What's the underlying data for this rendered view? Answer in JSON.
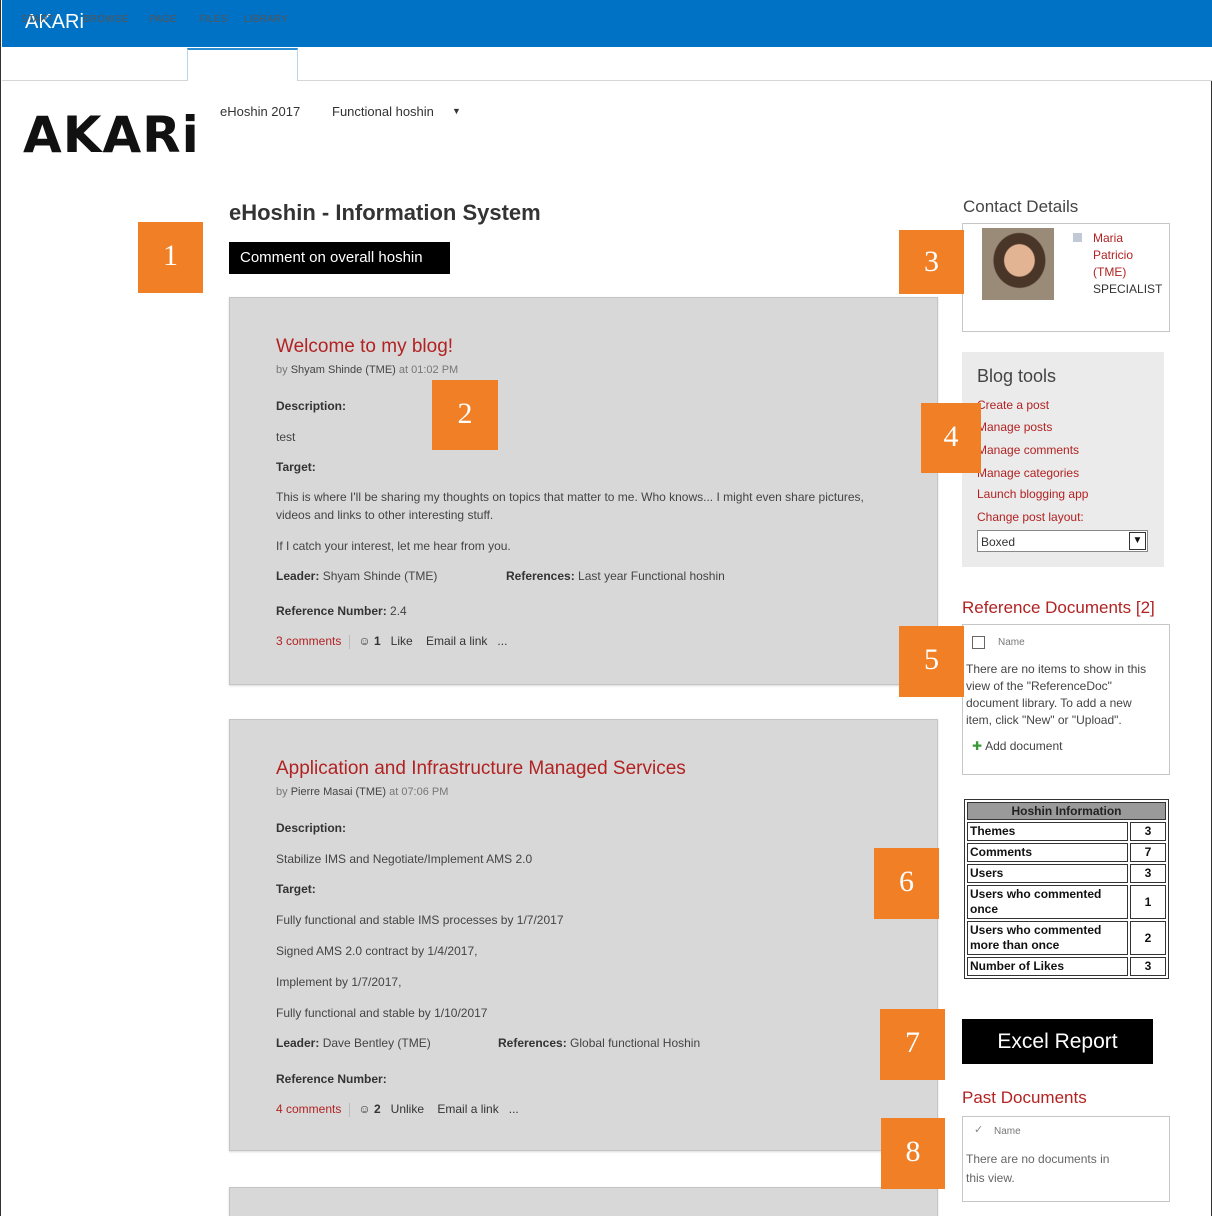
{
  "app": {
    "title": "AKARi",
    "logo_text": "AKARi"
  },
  "ribbon": {
    "tabs": [
      "START",
      "BROWSE",
      "PAGE",
      "FILES",
      "LIBRARY"
    ],
    "active_tabs": [
      "FILES",
      "LIBRARY"
    ]
  },
  "topnav": {
    "items": [
      "eHoshin 2017",
      "Functional hoshin"
    ],
    "dropdown_icon": "caret-down-icon"
  },
  "main": {
    "title": "eHoshin - Information System",
    "comment_button": "Comment on overall hoshin",
    "labels": {
      "description": "Description:",
      "target": "Target:",
      "leader": "Leader:",
      "references": "References:",
      "reference_number": "Reference Number:"
    },
    "posts": [
      {
        "title": "Welcome to my blog!",
        "by_prefix": "by",
        "author": "Shyam Shinde (TME)",
        "at": "at 01:02 PM",
        "description": "test",
        "target_lines": [
          "This is where I'll be sharing my thoughts on topics that matter to me. Who knows... I might even share pictures, videos and links to other interesting stuff.",
          "If I catch your interest, let me hear from you."
        ],
        "leader": "Shyam Shinde (TME)",
        "references": "Last year Functional hoshin",
        "reference_number": "2.4",
        "comments": "3 comments",
        "likes": "1",
        "like_action": "Like",
        "email_link": "Email a link",
        "more": "..."
      },
      {
        "title": "Application and Infrastructure Managed Services",
        "by_prefix": "by",
        "author": "Pierre Masai (TME)",
        "at": "at 07:06 PM",
        "description": "Stabilize IMS and Negotiate/Implement AMS 2.0",
        "target_lines": [
          "Fully functional and stable IMS processes by 1/7/2017",
          "Signed AMS 2.0 contract by 1/4/2017,",
          "Implement by 1/7/2017,",
          "Fully functional and stable by 1/10/2017"
        ],
        "leader": "Dave Bentley (TME)",
        "references": "Global functional Hoshin",
        "reference_number": "",
        "comments": "4 comments",
        "likes": "2",
        "like_action": "Unlike",
        "email_link": "Email a link",
        "more": "..."
      }
    ]
  },
  "contact": {
    "title": "Contact Details",
    "name": "Maria Patricio (TME)",
    "role": "SPECIALIST"
  },
  "blog_tools": {
    "title": "Blog tools",
    "links": [
      "Create a post",
      "Manage posts",
      "Manage comments",
      "Manage categories",
      "Launch blogging app",
      "Change post layout:"
    ],
    "layout_value": "Boxed"
  },
  "reference_docs": {
    "title": "Reference Documents [2]",
    "column": "Name",
    "empty_lines": [
      "There are no items to show in this",
      "view of the \"ReferenceDoc\"",
      "document library. To add a new",
      "item, click \"New\" or \"Upload\"."
    ],
    "add_label": "Add document"
  },
  "hoshin_info": {
    "header": "Hoshin Information",
    "rows": [
      {
        "label": "Themes",
        "value": "3"
      },
      {
        "label": "Comments",
        "value": "7"
      },
      {
        "label": "Users",
        "value": "3"
      },
      {
        "label": "Users who commented once",
        "value": "1"
      },
      {
        "label": "Users who commented more than once",
        "value": "2"
      },
      {
        "label": "Number of Likes",
        "value": "3"
      }
    ]
  },
  "excel_button": "Excel Report",
  "past_docs": {
    "title": "Past Documents",
    "column": "Name",
    "empty_lines": [
      "There are no documents in",
      "this view."
    ]
  },
  "markers": [
    "1",
    "2",
    "3",
    "4",
    "5",
    "6",
    "7",
    "8"
  ],
  "colors": {
    "topbar": "#0072c6",
    "link_red": "#b22222",
    "marker_orange": "#f07f26",
    "post_bg": "#d8d8d8"
  }
}
